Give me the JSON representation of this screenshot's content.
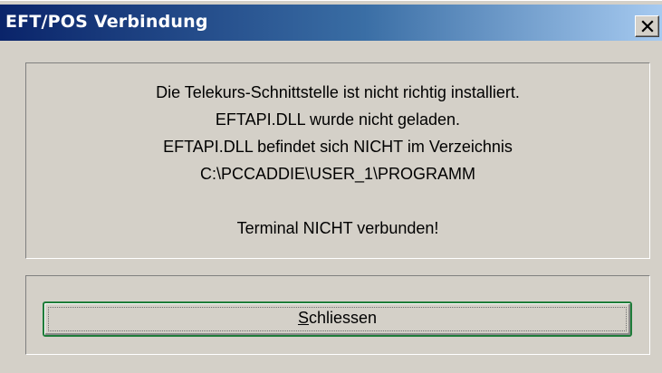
{
  "window": {
    "title": "EFT/POS Verbindung",
    "close_icon": "close-x-icon"
  },
  "message": {
    "lines": [
      "Die Telekurs-Schnittstelle ist nicht richtig installiert.",
      "EFTAPI.DLL wurde nicht geladen.",
      "EFTAPI.DLL befindet sich NICHT im Verzeichnis",
      "C:\\PCCADDIE\\USER_1\\PROGRAMM",
      "",
      "Terminal NICHT verbunden!"
    ]
  },
  "button": {
    "label_mnemonic": "S",
    "label_rest": "chliessen"
  },
  "colors": {
    "titlebar_start": "#0a246a",
    "titlebar_end": "#a6caf0",
    "face": "#d4d0c8",
    "button_focus_border": "#1f7d3a"
  }
}
